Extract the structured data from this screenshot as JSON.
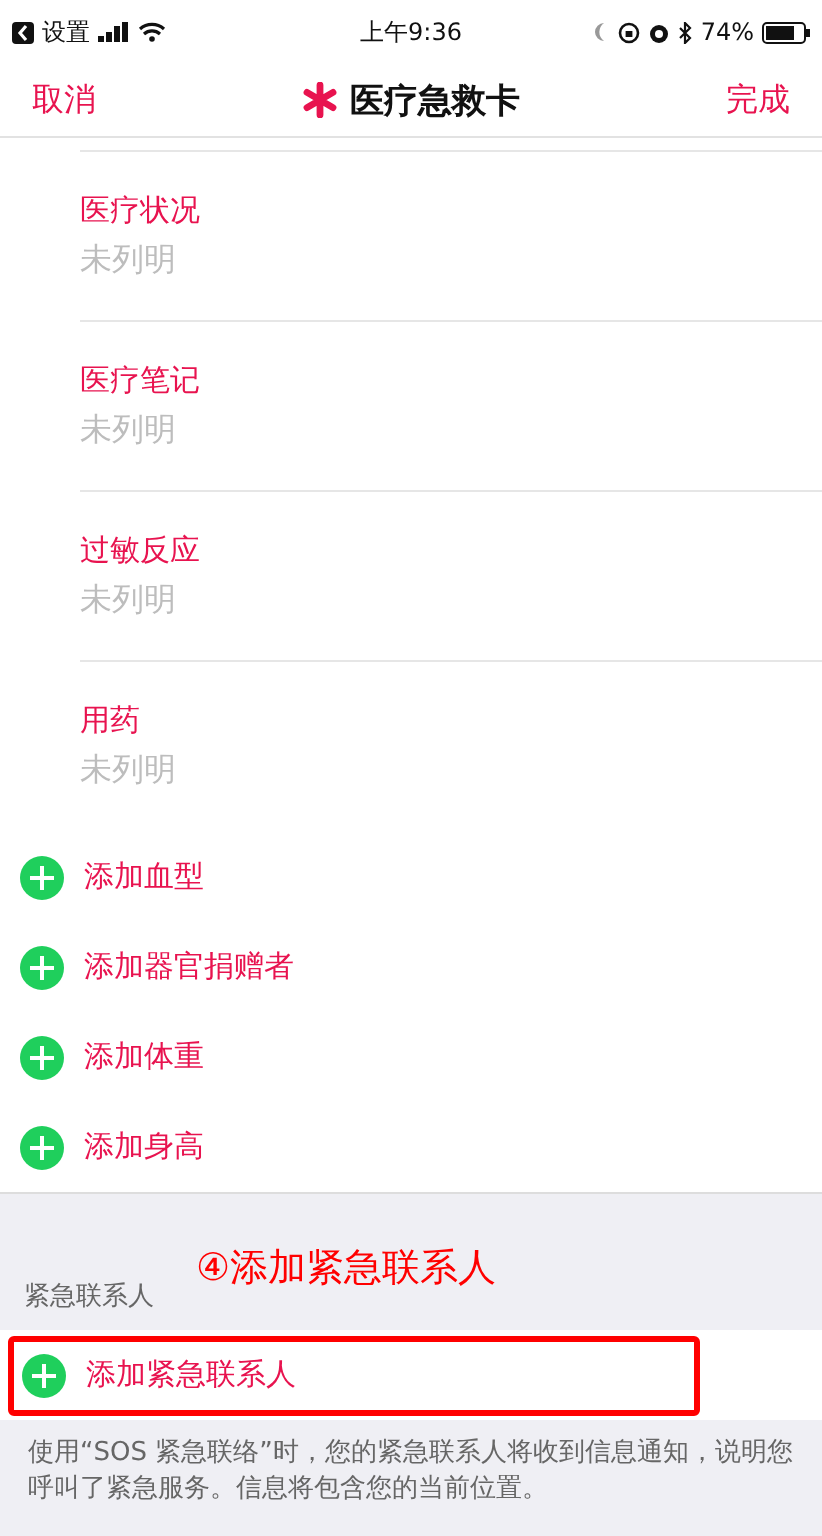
{
  "status_bar": {
    "back_label": "设置",
    "time": "上午9:36",
    "battery": "74%"
  },
  "nav": {
    "cancel": "取消",
    "title": "医疗急救卡",
    "done": "完成"
  },
  "fields": [
    {
      "label": "医疗状况",
      "value": "未列明"
    },
    {
      "label": "医疗笔记",
      "value": "未列明"
    },
    {
      "label": "过敏反应",
      "value": "未列明"
    },
    {
      "label": "用药",
      "value": "未列明"
    }
  ],
  "add_items": [
    {
      "label": "添加血型"
    },
    {
      "label": "添加器官捐赠者"
    },
    {
      "label": "添加体重"
    },
    {
      "label": "添加身高"
    }
  ],
  "emergency": {
    "header": "紧急联系人",
    "annotation": "④添加紧急联系人",
    "add_label": "添加紧急联系人",
    "highlighted": true,
    "footer": "使用“SOS 紧急联络”时，您的紧急联系人将收到信息通知，说明您呼叫了紧急服务。信息将包含您的当前位置。"
  }
}
